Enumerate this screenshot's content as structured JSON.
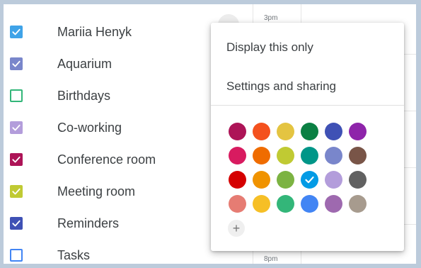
{
  "calendars": [
    {
      "label": "Mariia Henyk",
      "color": "#3fa3e8",
      "checked": true
    },
    {
      "label": "Aquarium",
      "color": "#7986cb",
      "checked": true
    },
    {
      "label": "Birthdays",
      "color": "#33b679",
      "checked": false
    },
    {
      "label": "Co-working",
      "color": "#b39ddb",
      "checked": true
    },
    {
      "label": "Conference room",
      "color": "#ad1457",
      "checked": true
    },
    {
      "label": "Meeting room",
      "color": "#c0ca33",
      "checked": true
    },
    {
      "label": "Reminders",
      "color": "#3f51b5",
      "checked": true
    },
    {
      "label": "Tasks",
      "color": "#4285f4",
      "checked": false
    }
  ],
  "times": [
    "3pm",
    "8pm"
  ],
  "menu": {
    "display_only": "Display this only",
    "settings_sharing": "Settings and sharing",
    "add_color": "+"
  },
  "palette": [
    [
      "#ad1457",
      "#f4511e",
      "#e4c441",
      "#0b8043",
      "#3f51b5",
      "#8e24aa"
    ],
    [
      "#d81b60",
      "#ef6c00",
      "#c0ca33",
      "#009688",
      "#7986cb",
      "#795548"
    ],
    [
      "#d50000",
      "#f09300",
      "#7cb342",
      "#039be5",
      "#b39ddb",
      "#616161"
    ],
    [
      "#e67c73",
      "#f6bf26",
      "#33b679",
      "#4285f4",
      "#9e69af",
      "#a79b8e"
    ]
  ],
  "selected_color": "#039be5"
}
